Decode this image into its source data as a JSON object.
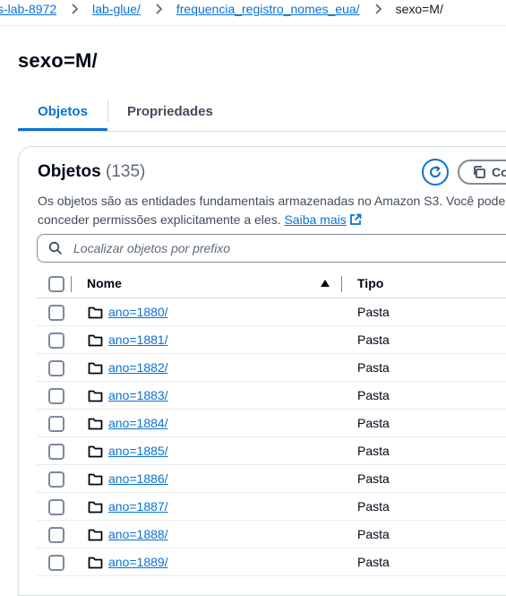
{
  "breadcrumb": {
    "items": [
      "s-lab-8972",
      "lab-glue/",
      "frequencia_registro_nomes_eua/"
    ],
    "current": "sexo=M/"
  },
  "page": {
    "title": "sexo=M/"
  },
  "tabs": [
    {
      "label": "Objetos",
      "active": true
    },
    {
      "label": "Propriedades",
      "active": false
    }
  ],
  "objects": {
    "title": "Objetos",
    "count": "(135)",
    "copy_label": "Co",
    "description_line1": "Os objetos são as entidades fundamentais armazenadas no Amazon S3. Você pode",
    "description_line2": "conceder permissões explicitamente a eles.",
    "learn_more": "Saiba mais",
    "search_placeholder": "Localizar objetos por prefixo"
  },
  "table": {
    "columns": {
      "name": "Nome",
      "type": "Tipo"
    },
    "sort": "ascending",
    "rows": [
      {
        "name": "ano=1880/",
        "type": "Pasta"
      },
      {
        "name": "ano=1881/",
        "type": "Pasta"
      },
      {
        "name": "ano=1882/",
        "type": "Pasta"
      },
      {
        "name": "ano=1883/",
        "type": "Pasta"
      },
      {
        "name": "ano=1884/",
        "type": "Pasta"
      },
      {
        "name": "ano=1885/",
        "type": "Pasta"
      },
      {
        "name": "ano=1886/",
        "type": "Pasta"
      },
      {
        "name": "ano=1887/",
        "type": "Pasta"
      },
      {
        "name": "ano=1888/",
        "type": "Pasta"
      },
      {
        "name": "ano=1889/",
        "type": "Pasta"
      }
    ]
  },
  "icons": {
    "breadcrumb_separator": "chevron-right-icon",
    "refresh": "refresh-icon",
    "copy": "copy-icon",
    "external": "external-link-icon",
    "search": "search-icon",
    "folder": "folder-icon",
    "sort": "sort-ascending-icon"
  },
  "colors": {
    "link": "#0972d3",
    "text": "#16191f",
    "border": "#d5dbdb"
  }
}
